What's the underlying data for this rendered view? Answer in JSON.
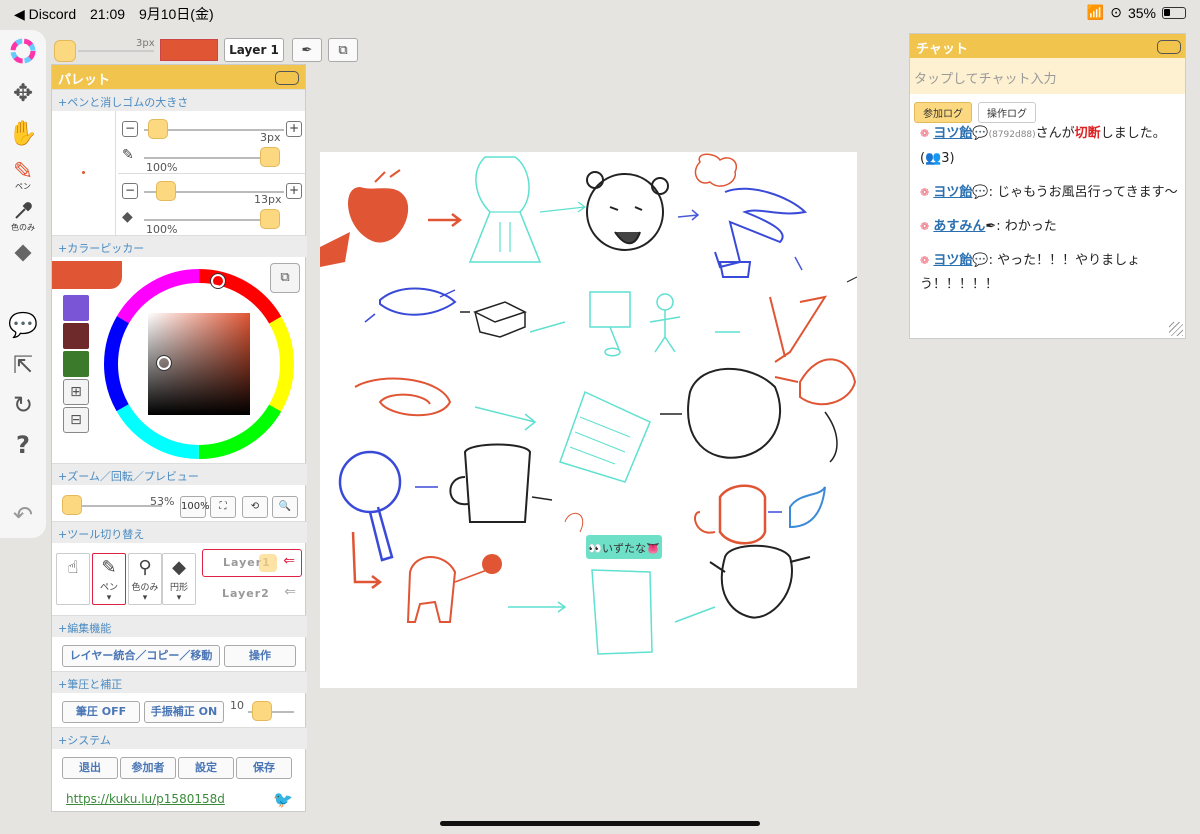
{
  "status": {
    "back_app": "◀ Discord",
    "time": "21:09",
    "date": "9月10日(金)",
    "battery": "35%"
  },
  "topbar": {
    "size_label": "3px",
    "layer_button": "Layer 1",
    "colors": {
      "current": "#e05534"
    }
  },
  "toolbar": {
    "pen_label": "ペン",
    "picker_label": "色のみ"
  },
  "palette": {
    "title": "パレット",
    "sections": {
      "pen_size": "+ペンと消しゴムの大きさ",
      "color_picker": "+カラーピッカー",
      "zoom": "+ズーム／回転／プレビュー",
      "tool_switch": "+ツール切り替え",
      "edit": "+編集機能",
      "pressure": "+筆圧と補正",
      "system": "+システム"
    },
    "pen": {
      "size": "3px",
      "opacity": "100%"
    },
    "eraser": {
      "size": "13px",
      "opacity": "100%"
    },
    "swatches": [
      "#7a56d6",
      "#6e2a2a",
      "#3a7a2a"
    ],
    "zoom_percent": "53%",
    "zoom_100": "100%",
    "tools": [
      {
        "name": "hand",
        "label": ""
      },
      {
        "name": "pen",
        "label": "ペン"
      },
      {
        "name": "picker",
        "label": "色のみ"
      },
      {
        "name": "eraser",
        "label": "円形"
      }
    ],
    "layers": [
      "Layer1",
      "Layer2"
    ],
    "edit_buttons": {
      "merge": "レイヤー統合／コピー／移動",
      "operate": "操作"
    },
    "pressure_buttons": {
      "pressure": "筆圧 OFF",
      "stabilizer": "手振補正 ON",
      "stabilizer_value": "10"
    },
    "system_buttons": [
      "退出",
      "参加者",
      "設定",
      "保存"
    ],
    "link": "https://kuku.lu/p1580158d"
  },
  "canvas": {
    "sticker_text": "👀いずたな👅"
  },
  "chat": {
    "title": "チャット",
    "input_placeholder": "タップしてチャット入力",
    "tabs": [
      "参加ログ",
      "操作ログ"
    ],
    "messages": [
      {
        "name": "ヨツ飴",
        "id": "(8792d88)",
        "pre": "さんが",
        "highlight": "切断",
        "post": "しました。(👥3)"
      },
      {
        "name": "ヨツ飴",
        "text": ": じゃもうお風呂行ってきます〜"
      },
      {
        "name": "あすみん",
        "text": ": わかった"
      },
      {
        "name": "ヨツ飴",
        "text": ": やった！！！やりましょう！！！！！"
      }
    ]
  }
}
